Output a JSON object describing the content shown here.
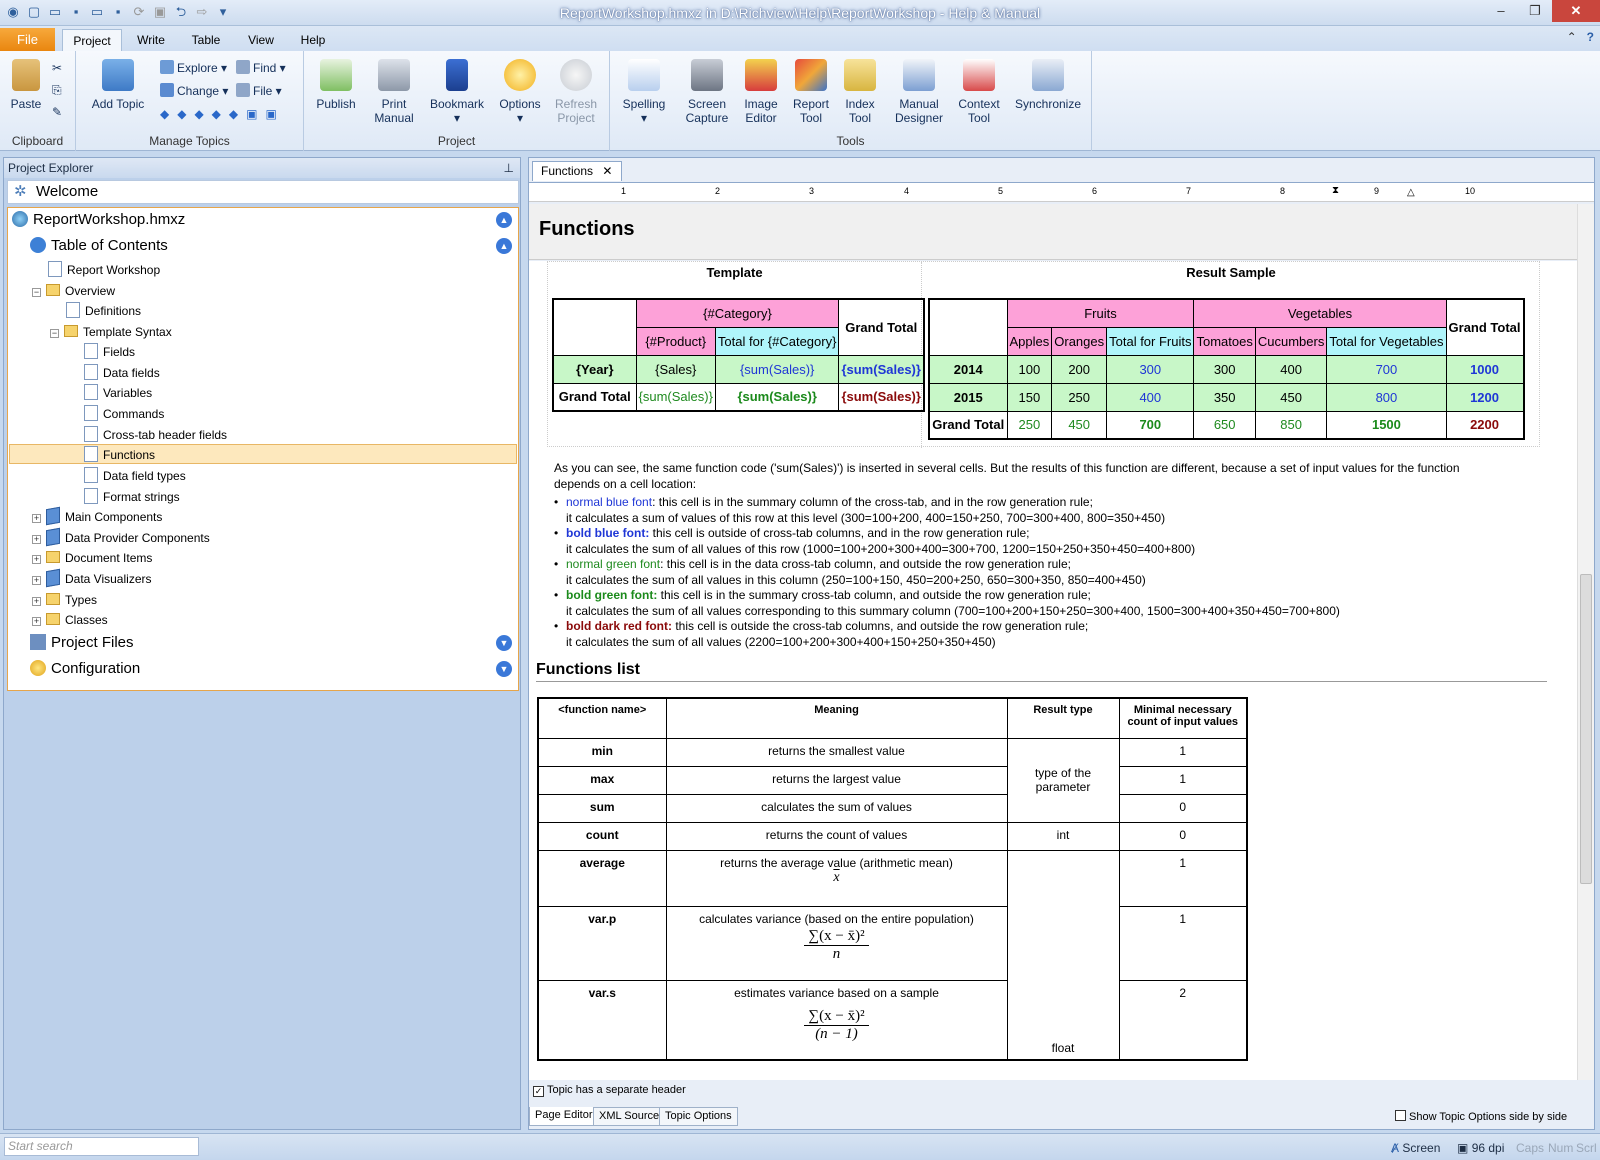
{
  "window": {
    "title": "ReportWorkshop.hmxz in D:\\Richview\\Help\\ReportWorkshop - Help & Manual"
  },
  "ribbon_tabs": [
    "File",
    "Project",
    "Write",
    "Table",
    "View",
    "Help"
  ],
  "ribbon": {
    "clipboard": {
      "paste": "Paste",
      "group": "Clipboard"
    },
    "manage": {
      "add_topic": "Add Topic",
      "explore": "Explore",
      "change": "Change",
      "find": "Find",
      "file": "File",
      "group": "Manage Topics"
    },
    "project": {
      "publish": "Publish",
      "print1": "Print",
      "print2": "Manual",
      "bookmark": "Bookmark",
      "options": "Options",
      "refresh1": "Refresh",
      "refresh2": "Project",
      "group": "Project"
    },
    "tools": {
      "spelling": "Spelling",
      "screen1": "Screen",
      "screen2": "Capture",
      "image1": "Image",
      "image2": "Editor",
      "report1": "Report",
      "report2": "Tool",
      "index1": "Index",
      "index2": "Tool",
      "manual1": "Manual",
      "manual2": "Designer",
      "context1": "Context",
      "context2": "Tool",
      "sync": "Synchronize",
      "group": "Tools"
    }
  },
  "explorer": {
    "title": "Project Explorer",
    "welcome": "Welcome",
    "project": "ReportWorkshop.hmxz",
    "toc": "Table of Contents",
    "items": [
      "Report Workshop",
      "Overview",
      "Definitions",
      "Template Syntax",
      "Fields",
      "Data fields",
      "Variables",
      "Commands",
      "Cross-tab header fields",
      "Functions",
      "Data field types",
      "Format strings",
      "Main Components",
      "Data Provider Components",
      "Document Items",
      "Data Visualizers",
      "Types",
      "Classes"
    ],
    "project_files": "Project Files",
    "configuration": "Configuration",
    "search_placeholder": "Start search"
  },
  "editor": {
    "tab": "Functions",
    "ruler": [
      "1",
      "2",
      "3",
      "4",
      "5",
      "6",
      "7",
      "8",
      "9",
      "10"
    ],
    "topic_title": "Functions",
    "template_header": "Template",
    "result_header": "Result Sample",
    "tpl": {
      "category": "{#Category}",
      "product": "{#Product}",
      "total_cat": "Total for {#Category}",
      "grand_total": "Grand Total",
      "year": "{Year}",
      "sales": "{Sales}",
      "sum_sales": "{sum(Sales)}"
    },
    "res": {
      "fruits": "Fruits",
      "vegetables": "Vegetables",
      "grand_total": "Grand Total",
      "cols": [
        "Apples",
        "Oranges",
        "Total for Fruits",
        "Tomatoes",
        "Cucumbers",
        "Total for Vegetables"
      ],
      "rows": [
        {
          "label": "2014",
          "vals": [
            "100",
            "200",
            "300",
            "300",
            "400",
            "700",
            "1000"
          ]
        },
        {
          "label": "2015",
          "vals": [
            "150",
            "250",
            "400",
            "350",
            "450",
            "800",
            "1200"
          ]
        },
        {
          "label": "Grand Total",
          "vals": [
            "250",
            "450",
            "700",
            "650",
            "850",
            "1500",
            "2200"
          ]
        }
      ]
    },
    "intro1": "As you can see, the same function code ('sum(Sales)') is inserted in several cells. But the results of this function are different, because a set of input values for the function",
    "intro2": "depends on a cell location:",
    "bullets": [
      {
        "label": "normal blue font",
        "rest": ": this cell is in the summary column of the cross-tab, and in the row generation rule;",
        "line2": "it calculates a sum of values of this row at this level (300=100+200, 400=150+250, 700=300+400, 800=350+450)"
      },
      {
        "label": "bold blue font:",
        "rest": " this cell is outside of cross-tab columns, and in the row generation rule;",
        "line2": "it calculates the sum of all values of this row (1000=100+200+300+400=300+700, 1200=150+250+350+450=400+800)"
      },
      {
        "label": "normal green font",
        "rest": ": this cell is in the data cross-tab column, and outside the row generation rule;",
        "line2": "it calculates the sum of all values in this column (250=100+150, 450=200+250, 650=300+350, 850=400+450)"
      },
      {
        "label": "bold green font:",
        "rest": " this cell is in the summary cross-tab column, and outside the row generation rule;",
        "line2": "it calculates the sum of all values corresponding to this summary column (700=100+200+150+250=300+400, 1500=300+400+350+450=700+800)"
      },
      {
        "label": "bold dark red font:",
        "rest": " this cell is outside the cross-tab columns, and outside the row generation rule;",
        "line2": "it calculates the sum of all values (2200=100+200+300+400+150+250+350+450)"
      }
    ],
    "functions_list_title": "Functions list",
    "ftable": {
      "headers": [
        "<function name>",
        "Meaning",
        "Result type",
        "Minimal necessary",
        "count of input values"
      ],
      "rows": [
        {
          "name": "min",
          "meaning": "returns the smallest value",
          "min": "1"
        },
        {
          "name": "max",
          "meaning": "returns the largest value",
          "min": "1"
        },
        {
          "name": "sum",
          "meaning": "calculates the sum of values",
          "min": "0"
        },
        {
          "name": "count",
          "meaning": "returns the count of values",
          "min": "0"
        },
        {
          "name": "average",
          "meaning": "returns the average value (arithmetic mean)",
          "min": "1"
        },
        {
          "name": "var.p",
          "meaning": "calculates variance (based on the entire population)",
          "min": "1"
        },
        {
          "name": "var.s",
          "meaning": "estimates variance based on a sample",
          "min": "2"
        }
      ],
      "type_param1": "type of the",
      "type_param2": "parameter",
      "type_int": "int",
      "type_float": "float",
      "formula_x": "x",
      "formula_n": "n",
      "formula_n1": "(n − 1)",
      "formula_sum": "∑(x − x̄)²"
    },
    "separate_header": "Topic has a separate header",
    "bottom_tabs": [
      "Page Editor",
      "XML Source",
      "Topic Options"
    ],
    "side_by_side": "Show Topic Options side by side"
  },
  "status": {
    "screen": "Screen",
    "dpi": "96 dpi",
    "caps": "Caps",
    "num": "Num",
    "scrl": "Scrl"
  }
}
